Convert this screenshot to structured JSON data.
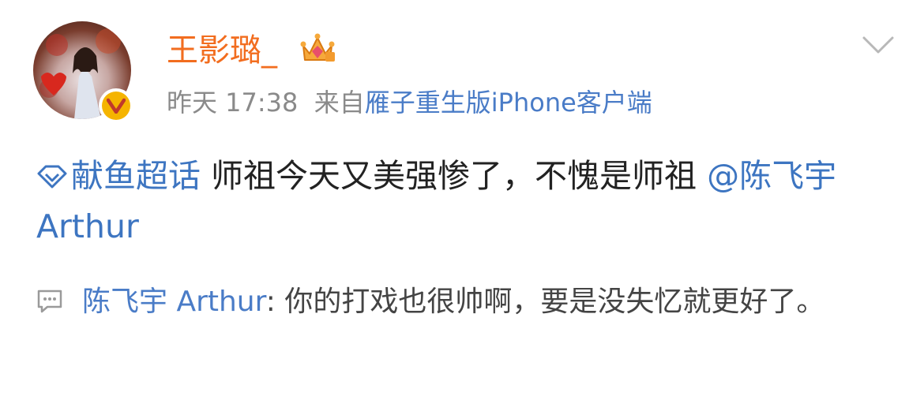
{
  "post": {
    "username": "王影璐_",
    "time": "昨天 17:38",
    "source_prefix": "来自",
    "source_app": "雁子重生版iPhone客户端",
    "topic": "献鱼超话",
    "body_text": "师祖今天又美强惨了，不愧是师祖",
    "mention": "@陈飞宇 Arthur"
  },
  "comment": {
    "author": "陈飞宇 Arthur",
    "separator": ": ",
    "text": "你的打戏也很帅啊，要是没失忆就更好了。"
  },
  "icons": {
    "avatar_badge": "verified-v-icon",
    "crown": "crown-icon",
    "menu": "chevron-down-icon",
    "topic": "diamond-topic-icon",
    "comment": "comment-bubble-icon"
  },
  "colors": {
    "username": "#f26d1f",
    "link": "#3d75c1",
    "meta": "#8a8a8a",
    "badge": "#f5b400"
  }
}
